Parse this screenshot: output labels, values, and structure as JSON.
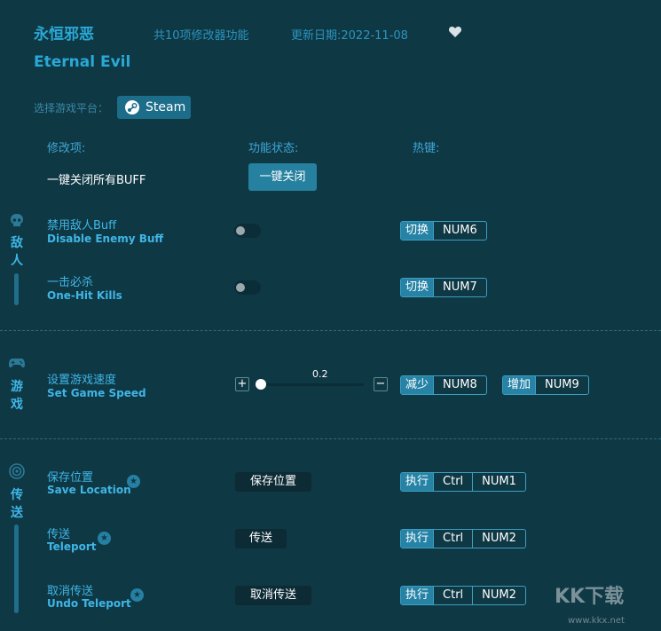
{
  "header": {
    "title_cn": "永恒邪恶",
    "title_en": "Eternal Evil",
    "feature_count": "共10项修改器功能",
    "update_date": "更新日期:2022-11-08"
  },
  "platform": {
    "label": "选择游戏平台：",
    "button": "Steam"
  },
  "columns": {
    "mod": "修改项:",
    "status": "功能状态:",
    "hotkey": "热键:"
  },
  "one_click": {
    "label": "一键关闭所有BUFF",
    "button": "一键关闭"
  },
  "sections": {
    "enemy": {
      "label_1": "敌",
      "label_2": "人"
    },
    "game": {
      "label_1": "游",
      "label_2": "戏"
    },
    "teleport": {
      "label_1": "传",
      "label_2": "送"
    }
  },
  "rows": {
    "disable_buff": {
      "cn": "禁用敌人Buff",
      "en": "Disable Enemy Buff",
      "action": "切换",
      "key": "NUM6"
    },
    "one_hit": {
      "cn": "一击必杀",
      "en": "One-Hit Kills",
      "action": "切换",
      "key": "NUM7"
    },
    "game_speed": {
      "cn": "设置游戏速度",
      "en": "Set Game Speed",
      "value": "0.2",
      "plus": "+",
      "minus": "−",
      "dec_action": "减少",
      "dec_key": "NUM8",
      "inc_action": "增加",
      "inc_key": "NUM9"
    },
    "save_location": {
      "cn": "保存位置",
      "en": "Save Location",
      "button": "保存位置",
      "action": "执行",
      "mod": "Ctrl",
      "key": "NUM1"
    },
    "teleport": {
      "cn": "传送",
      "en": "Teleport",
      "button": "传送",
      "action": "执行",
      "mod": "Ctrl",
      "key": "NUM2"
    },
    "undo_teleport": {
      "cn": "取消传送",
      "en": "Undo Teleport",
      "button": "取消传送",
      "action": "执行",
      "mod": "Ctrl",
      "key": "NUM2"
    }
  },
  "watermark": {
    "text": "KK下载",
    "url": "www.kkx.net"
  },
  "colors": {
    "background": "#0f3845",
    "accent": "#29a9d6",
    "button": "#2680a0"
  }
}
